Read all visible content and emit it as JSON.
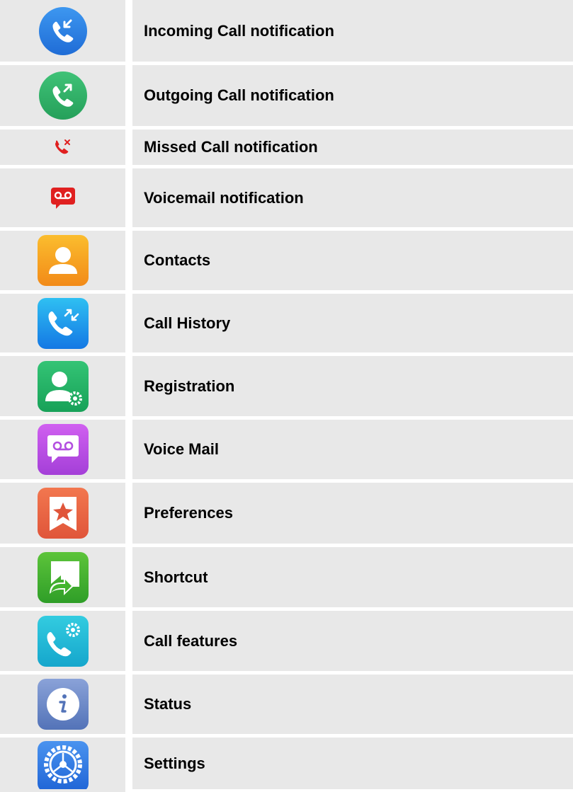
{
  "rows": [
    {
      "icon": "incoming-call-icon",
      "label": "Incoming Call notification"
    },
    {
      "icon": "outgoing-call-icon",
      "label": "Outgoing Call notification"
    },
    {
      "icon": "missed-call-icon",
      "label": "Missed Call notification"
    },
    {
      "icon": "voicemail-notification-icon",
      "label": "Voicemail notification"
    },
    {
      "icon": "contacts-icon",
      "label": "Contacts"
    },
    {
      "icon": "call-history-icon",
      "label": "Call History"
    },
    {
      "icon": "registration-icon",
      "label": "Registration"
    },
    {
      "icon": "voice-mail-icon",
      "label": "Voice Mail"
    },
    {
      "icon": "preferences-icon",
      "label": "Preferences"
    },
    {
      "icon": "shortcut-icon",
      "label": "Shortcut"
    },
    {
      "icon": "call-features-icon",
      "label": "Call features"
    },
    {
      "icon": "status-icon",
      "label": "Status"
    },
    {
      "icon": "settings-icon",
      "label": "Settings"
    }
  ],
  "colors": {
    "cell_background": "#e8e8e8",
    "incoming": "#2a7de1",
    "outgoing": "#2fb36a",
    "missed": "#e02020",
    "voicemail_notification": "#e02020",
    "contacts": "#f6a21c",
    "call_history": "#1a9cf0",
    "registration": "#23b36b",
    "voice_mail": "#b34fe0",
    "preferences": "#ec6442",
    "shortcut": "#43b52f",
    "call_features": "#1fb8d8",
    "status": "#6482c4",
    "settings": "#2d7ae6"
  }
}
